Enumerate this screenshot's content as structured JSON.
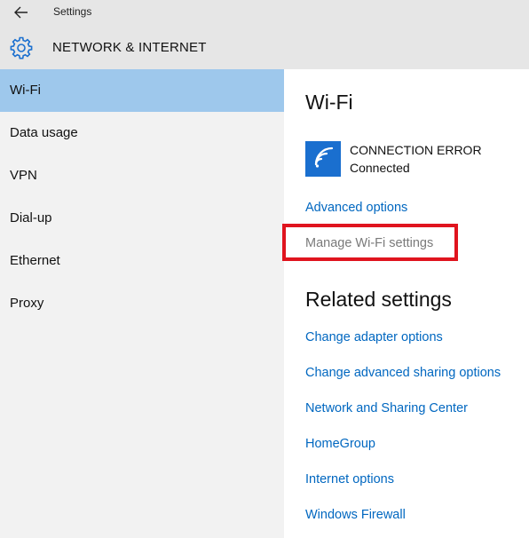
{
  "window": {
    "app_title": "Settings",
    "section_title": "NETWORK & INTERNET"
  },
  "sidebar": {
    "items": [
      {
        "label": "Wi-Fi",
        "selected": true
      },
      {
        "label": "Data usage"
      },
      {
        "label": "VPN"
      },
      {
        "label": "Dial-up"
      },
      {
        "label": "Ethernet"
      },
      {
        "label": "Proxy"
      }
    ]
  },
  "main": {
    "heading": "Wi-Fi",
    "connection": {
      "name": "CONNECTION ERROR",
      "status": "Connected",
      "icon": "wifi-icon"
    },
    "advanced_options": "Advanced options",
    "manage_wifi": "Manage Wi-Fi settings",
    "related_heading": "Related settings",
    "related_links": [
      "Change adapter options",
      "Change advanced sharing options",
      "Network and Sharing Center",
      "HomeGroup",
      "Internet options",
      "Windows Firewall"
    ]
  },
  "colors": {
    "accent": "#0067c0",
    "selected_nav": "#9ec8ec",
    "wifi_tile": "#1a6fcf",
    "highlight": "#e0141e"
  }
}
